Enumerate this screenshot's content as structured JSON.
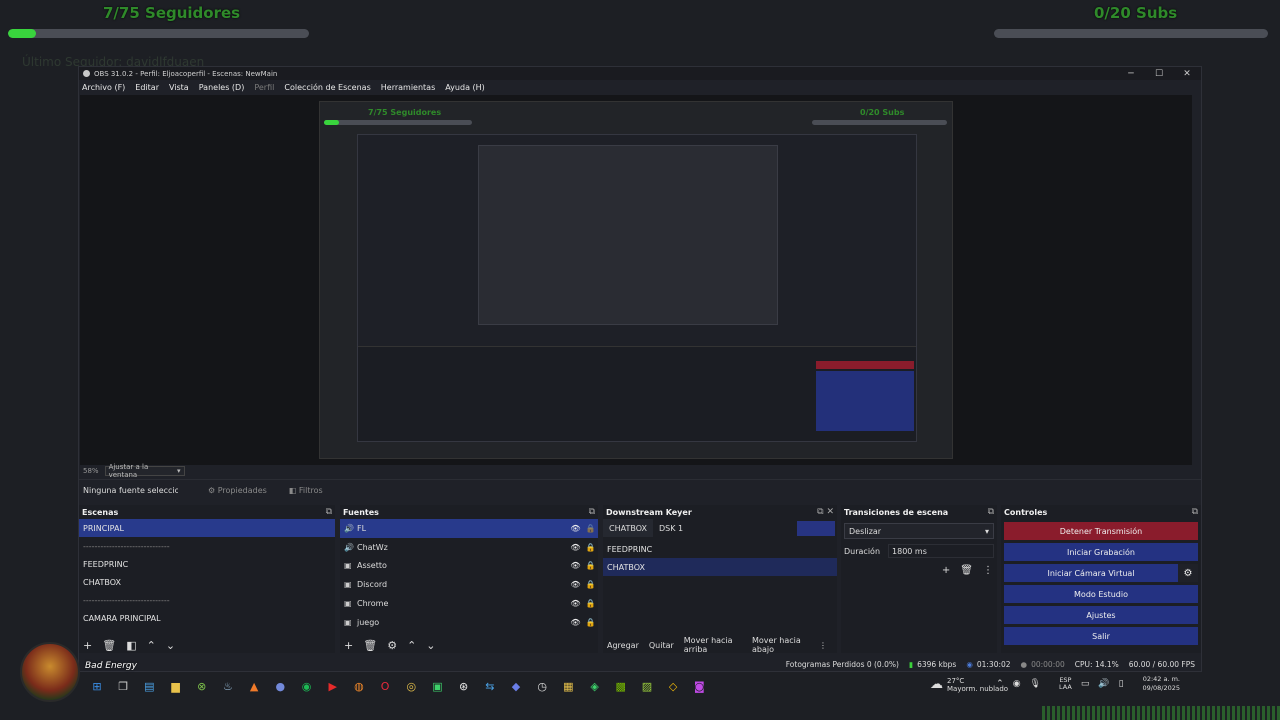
{
  "overlay": {
    "followers": "7/75 Seguidores",
    "subs": "0/20 Subs",
    "followers_progress": 0.093,
    "subs_progress": 0.0,
    "faded": "Último Seguidor: davidlfduaen"
  },
  "window": {
    "title": "OBS 31.0.2 - Perfil: Eljoacoperfil - Escenas: NewMain",
    "controls": [
      "─",
      "☐",
      "✕"
    ]
  },
  "menu": [
    "Archivo (F)",
    "Editar",
    "Vista",
    "Paneles (D)",
    "Perfil",
    "Colección de Escenas",
    "Herramientas",
    "Ayuda (H)"
  ],
  "preview": {
    "mini_followers": "7/75 Seguidores",
    "mini_subs": "0/20 Subs",
    "zoom": "58%",
    "zoom_mode": "Ajustar a la ventana"
  },
  "source_bar": {
    "none_selected": "Ninguna fuente seleccionada",
    "properties": "Propiedades",
    "filters": "Filtros"
  },
  "scenes": {
    "title": "Escenas",
    "items": [
      {
        "label": "PRINCIPAL",
        "selected": true
      },
      {
        "label": "------------------------------",
        "sep": true
      },
      {
        "label": "FEEDPRINC"
      },
      {
        "label": "CHATBOX"
      },
      {
        "label": "------------------------------",
        "sep": true
      },
      {
        "label": "CAMARA PRINCIPAL"
      }
    ]
  },
  "sources": {
    "title": "Fuentes",
    "items": [
      {
        "icon": "🔊",
        "label": "FL",
        "selected": true
      },
      {
        "icon": "🔊",
        "label": "ChatWz"
      },
      {
        "icon": "▣",
        "label": "Assetto"
      },
      {
        "icon": "▣",
        "label": "Discord"
      },
      {
        "icon": "▣",
        "label": "Chrome"
      },
      {
        "icon": "▣",
        "label": "juego"
      }
    ]
  },
  "dsk": {
    "title": "Downstream Keyer",
    "tabs": [
      "CHATBOX",
      "DSK 1"
    ],
    "items": [
      "FEEDPRINC",
      "CHATBOX"
    ],
    "buttons": [
      "Agregar",
      "Quitar",
      "Mover hacia arriba",
      "Mover hacia abajo"
    ]
  },
  "transitions": {
    "title": "Transiciones de escena",
    "selected": "Deslizar",
    "duration_label": "Duración",
    "duration_value": "1800 ms"
  },
  "controls": {
    "title": "Controles",
    "buttons": [
      "Detener Transmisión",
      "Iniciar Grabación",
      "Iniciar Cámara Virtual",
      "Modo Estudio",
      "Ajustes",
      "Salir"
    ]
  },
  "status": {
    "dropped": "Fotogramas Perdidos 0 (0.0%)",
    "bitrate": "6396 kbps",
    "live_time": "01:30:02",
    "rec_time": "00:00:00",
    "cpu": "CPU: 14.1%",
    "fps": "60.00 / 60.00 FPS"
  },
  "taskbar": {
    "user": "Bad Energy",
    "weather_temp": "27°C",
    "weather_desc": "Mayorm. nublado",
    "lang1": "ESP",
    "lang2": "LAA",
    "time": "02:42 a. m.",
    "date": "09/08/2025"
  }
}
